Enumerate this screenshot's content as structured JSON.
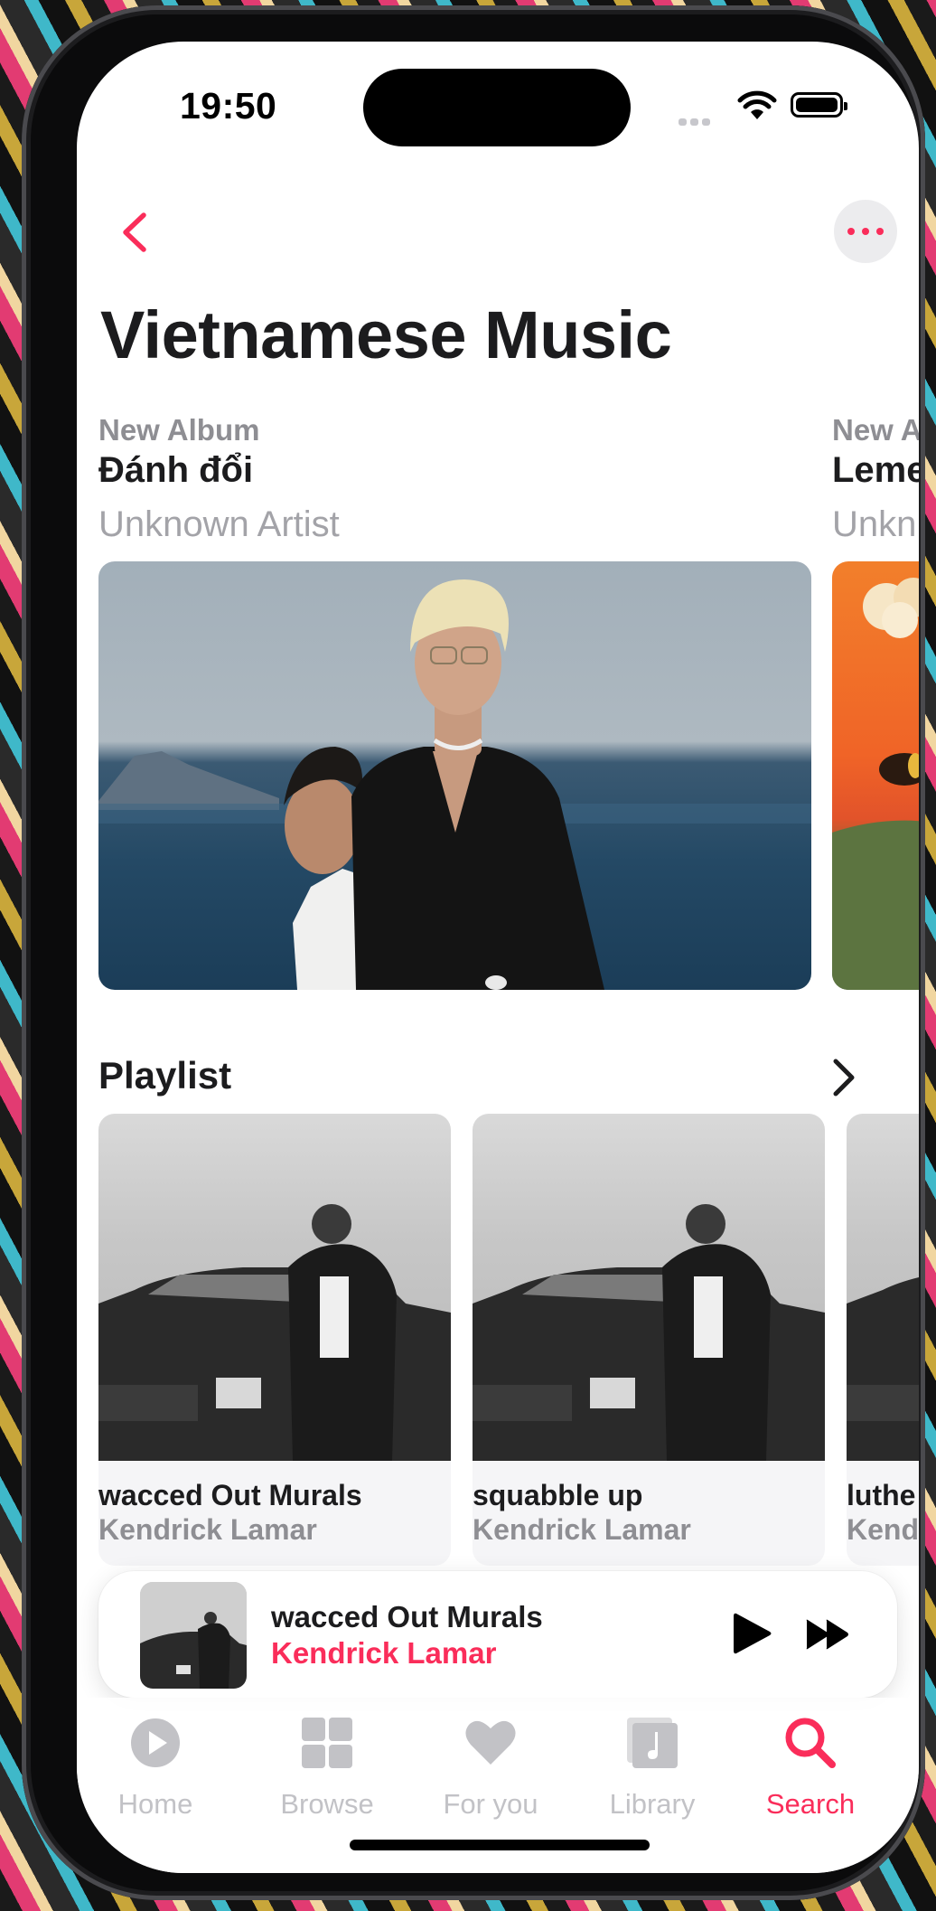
{
  "status_bar": {
    "time": "19:50"
  },
  "header": {
    "title": "Vietnamese Music",
    "back_icon": "chevron-left-icon",
    "more_icon": "ellipsis-icon"
  },
  "albums": [
    {
      "eyebrow": "New Album",
      "title": "Đánh đổi",
      "artist": "Unknown Artist"
    },
    {
      "eyebrow": "New A",
      "title": "Leme",
      "artist": "Unkn"
    }
  ],
  "playlist": {
    "section_title": "Playlist",
    "items": [
      {
        "title": "wacced Out Murals",
        "artist": "Kendrick Lamar"
      },
      {
        "title": "squabble up",
        "artist": "Kendrick Lamar"
      },
      {
        "title": "luthe",
        "artist": "Kend"
      }
    ]
  },
  "now_playing": {
    "title": "wacced Out Murals",
    "artist": "Kendrick Lamar"
  },
  "tabs": [
    {
      "label": "Home",
      "icon": "play-circle-icon"
    },
    {
      "label": "Browse",
      "icon": "grid-icon"
    },
    {
      "label": "For you",
      "icon": "heart-icon"
    },
    {
      "label": "Library",
      "icon": "music-library-icon"
    },
    {
      "label": "Search",
      "icon": "search-icon"
    }
  ],
  "active_tab": "Search",
  "colors": {
    "accent": "#fa2d5a",
    "text": "#1c1c1e",
    "secondary": "#8e8e93",
    "inactive": "#c2c2c6"
  }
}
